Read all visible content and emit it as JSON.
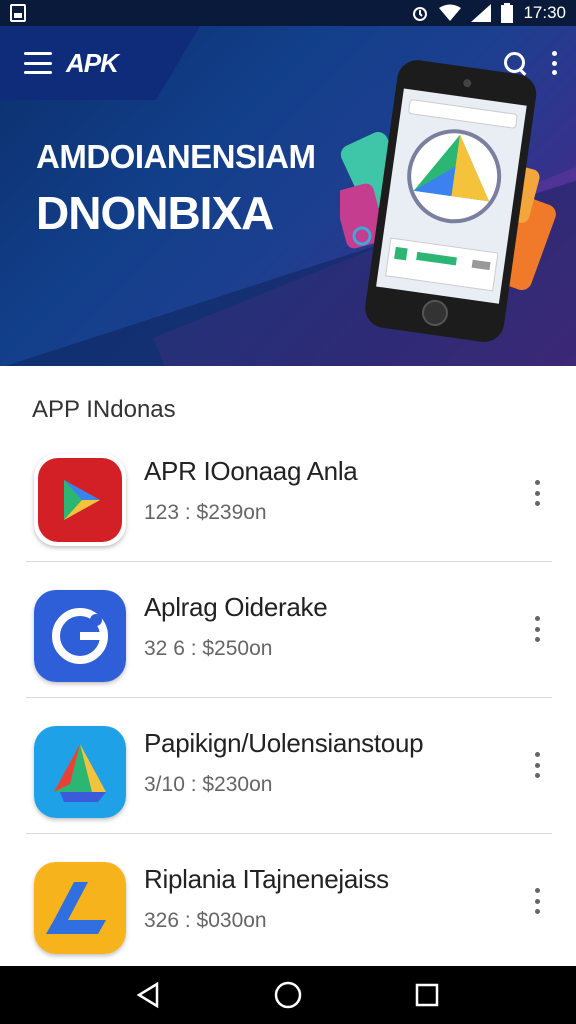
{
  "status_bar": {
    "time": "17:30",
    "icons": [
      "sim-icon",
      "alarm-icon",
      "wifi-icon",
      "signal-icon",
      "battery-icon"
    ]
  },
  "toolbar": {
    "logo_text": "APK",
    "icons": [
      "menu-icon",
      "search-icon",
      "more-vert-icon"
    ]
  },
  "hero": {
    "line1": "AMDOIANENSIAM",
    "line2": "DNONBIXA",
    "colors": {
      "start": "#0b2f6b",
      "end": "#5a2c8c"
    }
  },
  "section": {
    "title": "APP INdonas"
  },
  "apps": [
    {
      "name": "APR IOonaag Anla",
      "meta": "123 : $239on",
      "icon": "red-play-icon",
      "color": "#d32027"
    },
    {
      "name": "Aplrag Oiderake",
      "meta": "32 6 : $250on",
      "icon": "blue-g-icon",
      "color": "#2f5fd8"
    },
    {
      "name": "Papikign/Uolensianstoup",
      "meta": "3/10 : $230on",
      "icon": "drive-triangle-icon",
      "color": "#1ea1e6"
    },
    {
      "name": "Riplania ITajnenejaiss",
      "meta": "326 : $030on",
      "icon": "yellow-l-icon",
      "color": "#f7b31c"
    }
  ],
  "nav_bar": {
    "icons": [
      "back-icon",
      "home-icon",
      "recents-icon"
    ]
  }
}
